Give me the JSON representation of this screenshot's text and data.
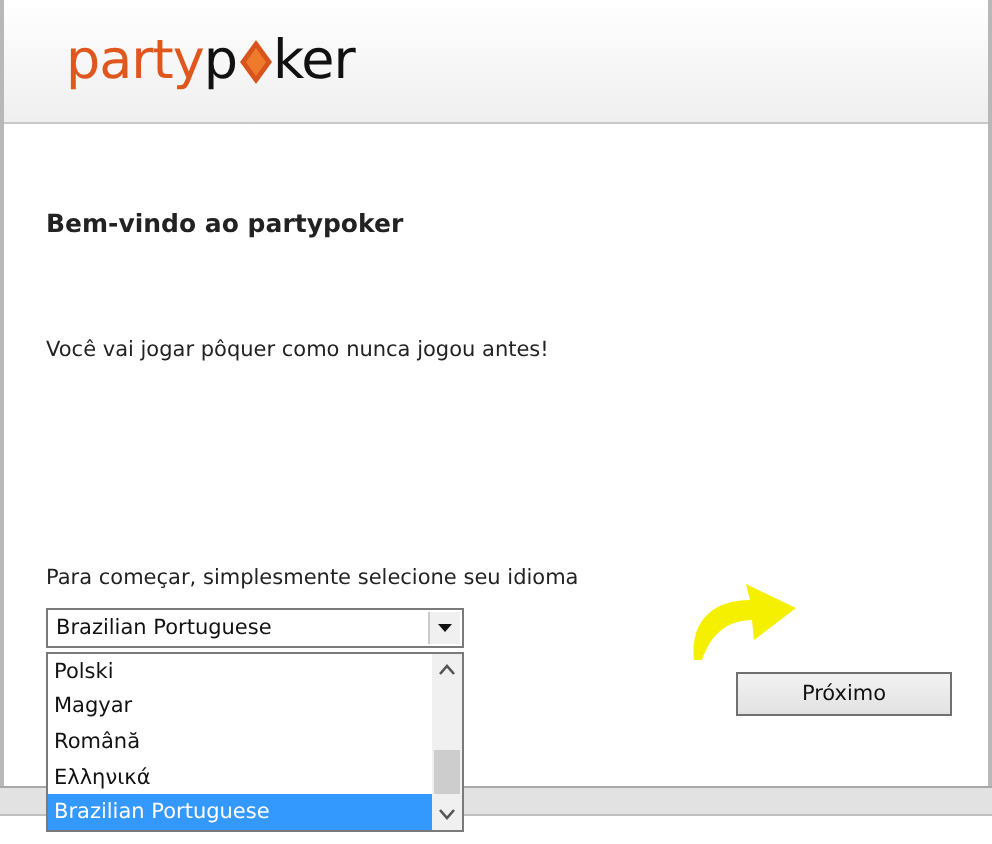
{
  "logo": {
    "brand_first": "party",
    "brand_second_start": "p",
    "brand_second_end": "ker"
  },
  "heading": "Bem-vindo ao partypoker",
  "intro": "Você vai jogar pôquer como nunca jogou antes!",
  "language_prompt": "Para começar, simplesmente selecione seu idioma",
  "language_select": {
    "value": "Brazilian Portuguese",
    "options": [
      {
        "label": "Polski",
        "selected": false
      },
      {
        "label": "Magyar",
        "selected": false
      },
      {
        "label": "Română",
        "selected": false
      },
      {
        "label": "Ελληνικά",
        "selected": false
      },
      {
        "label": "Brazilian Portuguese",
        "selected": true
      }
    ]
  },
  "next_button": "Próximo"
}
